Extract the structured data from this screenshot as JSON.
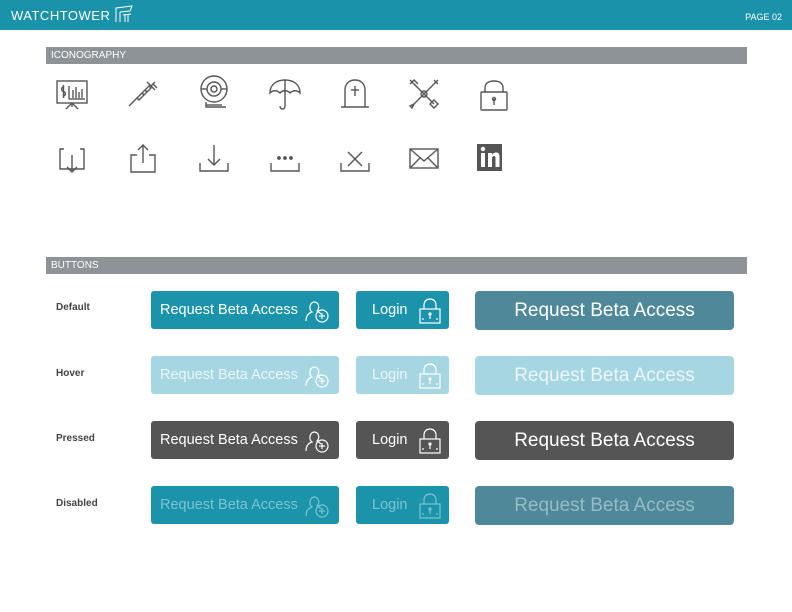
{
  "header": {
    "brand": "WATCHTOWER",
    "page": "PAGE 02",
    "accent_color": "#1a92aa"
  },
  "iconography": {
    "title": "ICONOGRAPHY",
    "row1": [
      "presentation-chart-icon",
      "syringe-icon",
      "webcam-icon",
      "umbrella-icon",
      "tombstone-icon",
      "crossed-tools-icon",
      "padlock-icon"
    ],
    "row2": [
      "inbox-icon",
      "share-icon",
      "download-icon",
      "more-icon",
      "clear-icon",
      "mail-icon",
      "linkedin-icon"
    ]
  },
  "buttons": {
    "title": "BUTTONS",
    "request_label": "Request Beta Access",
    "login_label": "Login",
    "states": [
      {
        "name": "Default",
        "primary": "#1b93ab",
        "large": "#4f8899"
      },
      {
        "name": "Hover",
        "primary": "#a6d6e1",
        "large": "#a6d6e1"
      },
      {
        "name": "Pressed",
        "primary": "#555555",
        "large": "#555555"
      },
      {
        "name": "Disabled",
        "primary": "#1b93ab",
        "large": "#4f8899"
      }
    ]
  }
}
